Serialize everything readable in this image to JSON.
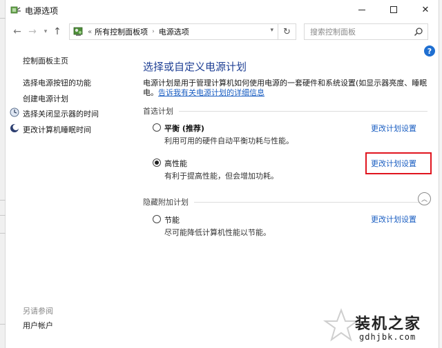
{
  "window": {
    "title": "电源选项",
    "min_label": "—",
    "close_label": "✕"
  },
  "nav": {
    "back": "←",
    "forward": "→",
    "recent": "▾",
    "up": "↑"
  },
  "address": {
    "prefix": "«",
    "segments": [
      "所有控制面板项",
      "电源选项"
    ],
    "separator": "›",
    "dropdown": "▾"
  },
  "refresh_label": "↻",
  "search": {
    "placeholder": "搜索控制面板"
  },
  "help_label": "?",
  "sidebar": {
    "home": "控制面板主页",
    "items": [
      {
        "label": "选择电源按钮的功能"
      },
      {
        "label": "创建电源计划"
      },
      {
        "label": "选择关闭显示器的时间"
      },
      {
        "label": "更改计算机睡眠时间"
      }
    ],
    "see_also": "另请参阅",
    "user_accounts": "用户帐户"
  },
  "main": {
    "title": "选择或自定义电源计划",
    "description": "电源计划是用于管理计算机如何使用电源的一套硬件和系统设置(如显示器亮度、睡眠",
    "desc_prefix": "电。",
    "desc_link": "告诉我有关电源计划的详细信息",
    "preferred_header": "首选计划",
    "hidden_header": "隐藏附加计划",
    "change_label": "更改计划设置",
    "plans": [
      {
        "name": "平衡 (推荐)",
        "desc": "利用可用的硬件自动平衡功耗与性能。",
        "selected": false
      },
      {
        "name": "高性能",
        "desc": "有利于提高性能，但会增加功耗。",
        "selected": true
      },
      {
        "name": "节能",
        "desc": "尽可能降低计算机性能以节能。",
        "selected": false
      }
    ],
    "collapse_label": "︿"
  },
  "watermark": {
    "title": "装机之家",
    "url": "gdhjbk.com"
  },
  "colors": {
    "link": "#1a5ec2",
    "title_blue": "#1e3f94",
    "highlight_red": "#e0141e"
  }
}
